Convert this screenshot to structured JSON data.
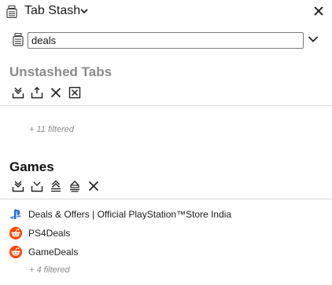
{
  "header": {
    "title": "Tab Stash",
    "icon": "stash-icon",
    "menu_icon": "chevron-down-icon",
    "close_icon": "close-icon"
  },
  "search": {
    "value": "deals",
    "placeholder": "",
    "icon": "stash-icon",
    "expand_icon": "chevron-down-icon"
  },
  "unstashed": {
    "title": "Unstashed Tabs",
    "actions": [
      "stash-all-icon",
      "stash-selected-icon",
      "close-icon",
      "close-window-icon"
    ],
    "filtered_note": "+ 11 filtered"
  },
  "games": {
    "title": "Games",
    "actions": [
      "stash-here-icon",
      "stash-selected-here-icon",
      "restore-all-icon",
      "restore-all-remove-icon",
      "delete-icon"
    ],
    "items": [
      {
        "label": "Deals & Offers | Official PlayStation™Store India",
        "icon": "playstation-favicon"
      },
      {
        "label": "PS4Deals",
        "icon": "reddit-favicon"
      },
      {
        "label": "GameDeals",
        "icon": "reddit-favicon"
      }
    ],
    "filtered_note": "+ 4 filtered"
  },
  "colors": {
    "muted_heading": "#8a8a8a",
    "reddit": "#ff4500",
    "playstation": "#1f6fd6"
  }
}
